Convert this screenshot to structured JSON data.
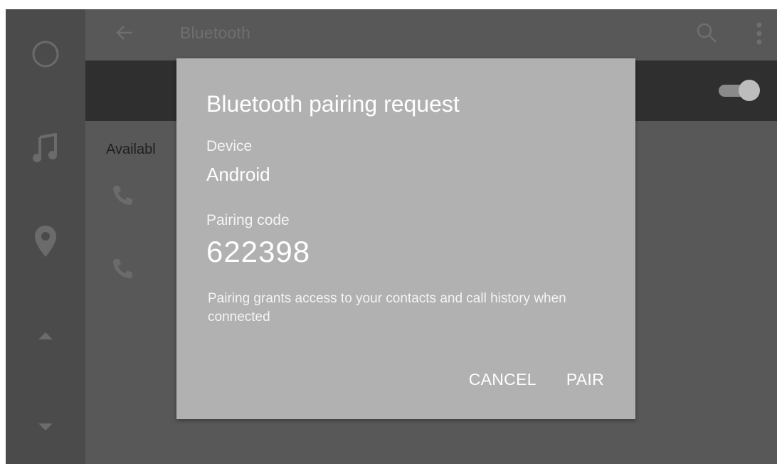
{
  "app_bar": {
    "title": "Bluetooth",
    "back_icon": "arrow-back-icon",
    "search_icon": "search-icon",
    "more_icon": "more-vert-icon"
  },
  "rail": {
    "items": [
      {
        "icon": "home-circle-icon"
      },
      {
        "icon": "music-note-icon"
      },
      {
        "icon": "location-pin-icon"
      },
      {
        "icon": "chevron-up-icon"
      },
      {
        "icon": "chevron-down-icon"
      }
    ]
  },
  "bluetooth_toggle": {
    "state": "on"
  },
  "list": {
    "header": "Availabl",
    "devices": [
      {
        "icon": "phone-icon"
      },
      {
        "icon": "phone-icon"
      }
    ]
  },
  "dialog": {
    "title": "Bluetooth pairing request",
    "device_label": "Device",
    "device_value": "Android",
    "code_label": "Pairing code",
    "code_value": "622398",
    "message": "Pairing grants access to your contacts and call history when connected",
    "cancel_label": "CANCEL",
    "pair_label": "PAIR"
  },
  "colors": {
    "screen_bg": "#595858",
    "rail_bg": "#4c4b4b",
    "toggle_row_bg": "#2f2f2f",
    "dialog_bg": "#b1b1b1",
    "dialog_text": "#ffffff"
  }
}
